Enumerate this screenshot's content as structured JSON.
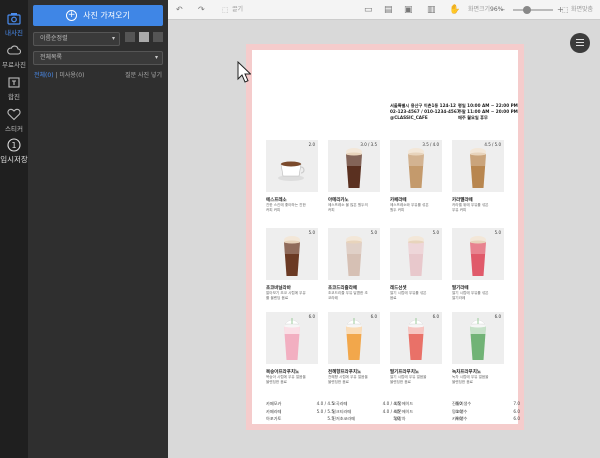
{
  "sidebar": {
    "items": [
      {
        "icon": "photo-icon",
        "label": "내사진",
        "active": true
      },
      {
        "icon": "cloud-icon",
        "label": "무료사진",
        "active": false
      },
      {
        "icon": "text-icon",
        "label": "합진",
        "active": false
      },
      {
        "icon": "heart-icon",
        "label": "스티커",
        "active": false
      },
      {
        "icon": "info-icon",
        "label": "임시저장",
        "active": false
      }
    ]
  },
  "panel": {
    "upload_label": "사진 가져오기",
    "sort_label": "이름순정렬",
    "list_label": "전체목록",
    "tab_all": "전체(0)",
    "tab_separator": " | ",
    "tab_unused": "미사용(0)",
    "help_link": "질문 사진 넣기"
  },
  "toolbar": {
    "undo_icon": "undo-icon",
    "redo_icon": "redo-icon",
    "move_label": "끌기",
    "zoom_label": "화면크기",
    "zoom_value": "96%",
    "fit_label": "화면맞춤"
  },
  "menu": {
    "address_line1": "서울특별시 용산구 이촌1동 124-12",
    "address_line2": "02-123-4567 / 010-1234-4567",
    "address_line3": "@CLASSIC_CAFE",
    "hours_line1": "평일 10:00 AM ~ 22:00 PM",
    "hours_line2": "주말 11:00 AM ~ 20:00 PM",
    "hours_line3": "매주 월요일 휴무",
    "cards": [
      {
        "name": "에스프레소",
        "price": "2.0",
        "desc": "진한 스킨에 좋아하는 진한 커피 커피",
        "color": "#7b4a2c",
        "type": "cup"
      },
      {
        "name": "아메리카노",
        "price": "3.0 / 3.5",
        "desc": "에스프레소 물 많은 원두의 커피",
        "color": "#5a3020",
        "type": "iced"
      },
      {
        "name": "카페라떼",
        "price": "3.5 / 4.0",
        "desc": "에스프레소와 우유를 섞은 원두 커피",
        "color": "#c49a6c",
        "type": "iced"
      },
      {
        "name": "카라멜라떼",
        "price": "4.5 / 5.0",
        "desc": "카라멜 위에 우유를 섞은 우유 커피",
        "color": "#b8864f",
        "type": "iced"
      },
      {
        "name": "초코바닐라바",
        "price": "5.0",
        "desc": "알아보기 초코 시럽에 우유를 블렌딩 음료",
        "color": "#6b3a24",
        "type": "iced"
      },
      {
        "name": "초코드리즐라떼",
        "price": "5.0",
        "desc": "초코드리즐 우유 달콤한 초코라떼",
        "color": "#d6c0b4",
        "type": "iced"
      },
      {
        "name": "레드선셋",
        "price": "5.0",
        "desc": "딸기 시럽에 우유를 섞은 음료",
        "color": "#e8c8cc",
        "type": "iced"
      },
      {
        "name": "딸기라떼",
        "price": "5.0",
        "desc": "딸기 시럽에 우유를 섞은 딸기라떼",
        "color": "#e05a6a",
        "type": "iced"
      },
      {
        "name": "복숭아프라푸치노",
        "price": "6.0",
        "desc": "복숭아 시럽에 우유 얼음을 블렌딩한 음료",
        "color": "#f2a3b8",
        "type": "frappe"
      },
      {
        "name": "천혜향프라푸치노",
        "price": "6.0",
        "desc": "천혜향 시럽에 우유 얼음을 블렌딩한 음료",
        "color": "#f29a2e",
        "type": "frappe"
      },
      {
        "name": "딸기프라푸치노",
        "price": "6.0",
        "desc": "딸기 시럽에 우유 얼음을 블렌딩한 음료",
        "color": "#e85a50",
        "type": "frappe"
      },
      {
        "name": "녹차프라푸치노",
        "price": "6.0",
        "desc": "녹차 시럽에 우유 얼음을 블렌딩한 음료",
        "color": "#5aa860",
        "type": "frappe"
      }
    ],
    "list_columns": [
      [
        {
          "name": "카페모카",
          "price": "4.0 / 4.5"
        },
        {
          "name": "카페라떼",
          "price": "5.0 / 5.5"
        },
        {
          "name": "아포가토",
          "price": "5.5"
        }
      ],
      [
        {
          "name": "오곡라떼",
          "price": "4.0 / 4.5"
        },
        {
          "name": "밀크티라떼",
          "price": "4.0 / 4.5"
        },
        {
          "name": "진저초코라떼",
          "price": "5.0"
        }
      ],
      [
        {
          "name": "자몽에이드",
          "price": "4.0"
        },
        {
          "name": "레몬에이드",
          "price": "4.0"
        },
        {
          "name": "생강차",
          "price": "4.0"
        }
      ],
      [
        {
          "name": "진딸기생수",
          "price": "7.0"
        },
        {
          "name": "망고생수",
          "price": "6.0"
        },
        {
          "name": "키위생수",
          "price": "6.0"
        }
      ]
    ]
  }
}
